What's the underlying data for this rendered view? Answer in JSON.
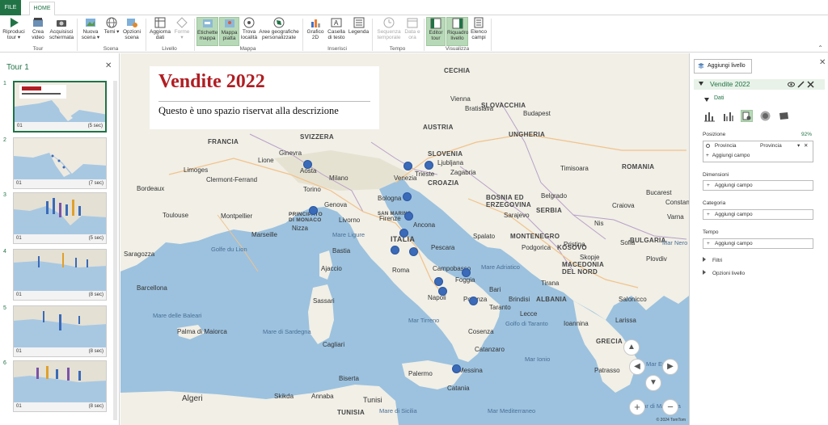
{
  "ribbon_tabs": {
    "file": "FILE",
    "home": "HOME"
  },
  "ribbon": {
    "tour_buttons": [
      "Riproduci tour ▾",
      "Crea video",
      "Acquisisci schermata"
    ],
    "scene_buttons": [
      "Nuova scena ▾",
      "Temi ▾",
      "Opzioni scena"
    ],
    "level_buttons": [
      "Aggiorna dati",
      "Forme ▾"
    ],
    "map_buttons": [
      "Etichette mappa",
      "Mappa piatta",
      "Trova località",
      "Aree geografiche personalizzate"
    ],
    "insert_buttons": [
      "Grafico 2D",
      "Casella di testo",
      "Legenda"
    ],
    "time_buttons": [
      "Sequenza temporale",
      "Data e ora"
    ],
    "view_buttons": [
      "Editor tour",
      "Riquadro livello",
      "Elenco campi"
    ],
    "groups": {
      "tour": "Tour",
      "scene": "Scena",
      "level": "Livello",
      "map": "Mappa",
      "insert": "Inserisci",
      "time": "Tempo",
      "view": "Visualizza"
    }
  },
  "tour_panel": {
    "title": "Tour 1",
    "scenes": [
      {
        "number": "1",
        "label": "01",
        "duration": "(5 sec)"
      },
      {
        "number": "2",
        "label": "01",
        "duration": "(7 sec)"
      },
      {
        "number": "3",
        "label": "01",
        "duration": "(5 sec)"
      },
      {
        "number": "4",
        "label": "01",
        "duration": "(8 sec)"
      },
      {
        "number": "5",
        "label": "01",
        "duration": "(8 sec)"
      },
      {
        "number": "6",
        "label": "01",
        "duration": "(8 sec)"
      }
    ]
  },
  "map": {
    "title": "Vendite 2022",
    "description": "Questo è uno spazio riservat alla descrizione",
    "copyright": "© 2024 TomTom",
    "countries": [
      "FRANCIA",
      "SVIZZERA",
      "AUSTRIA",
      "CECHIA",
      "SLOVACCHIA",
      "UNGHERIA",
      "SLOVENIA",
      "CROAZIA",
      "BOSNIA ED ERZEGOVINA",
      "SERBIA",
      "ROMANIA",
      "MONTENEGRO",
      "KOSOVO",
      "BULGARIA",
      "MACEDONIA DEL NORD",
      "ALBANIA",
      "ITALIA",
      "GRECIA",
      "TUNISIA",
      "PRINCIPATO DI MONACO",
      "SAN MARINO"
    ],
    "cities": [
      "Bordeaux",
      "Limoges",
      "Clermont-Ferrand",
      "Montpellier",
      "Marseille",
      "Toulouse",
      "Genova",
      "Torino",
      "Milano",
      "Aosta",
      "Venezia",
      "Trieste",
      "Zagabria",
      "Bologna",
      "Firenze",
      "Ancona",
      "Roma",
      "Napoli",
      "Foggia",
      "Bari",
      "Taranto",
      "Palermo",
      "Messina",
      "Catania",
      "Sarajevo",
      "Belgrado",
      "Bucarest",
      "Sofia",
      "Skopje",
      "Tirana",
      "Podgorica",
      "Budapest",
      "Vienna",
      "Bratislava",
      "Ljubljana",
      "Spalato",
      "Pristina",
      "Nis",
      "Craiova",
      "Timisoara",
      "Lione",
      "Ginevra",
      "Nizza",
      "Livorno",
      "Pescara",
      "Campobasso",
      "Potenza",
      "Catanzaro",
      "Cosenza",
      "Bastia",
      "Ajaccio",
      "Cagliari",
      "Sassari",
      "Algeri",
      "Tunisi",
      "Biserta",
      "Skikda",
      "Annaba",
      "Palma di Maiorca",
      "Barcellona",
      "Saragozza",
      "Salonicco",
      "Patrasso",
      "Larissa",
      "Ioannina",
      "Brindisi",
      "Lecce",
      "Plovdiv",
      "Varna",
      "Constanta"
    ],
    "seas": [
      "Mare Ligure",
      "Mare Adriatico",
      "Mar Tirreno",
      "Mar Ionio",
      "Mar Mediterraneo",
      "Mare delle Baleari",
      "Mare di Sardegna",
      "Golfe du Lion",
      "Mar Egeo",
      "Mare di Sicilia",
      "Mar di Marmara",
      "Mar Nero",
      "Golfo di Taranto"
    ],
    "data_points": 19,
    "nav": {
      "up": "▲",
      "left": "◀",
      "right": "▶",
      "down": "▼",
      "zoom_in": "+",
      "zoom_out": "−"
    }
  },
  "layer_pane": {
    "add_layer": "Aggiungi livello",
    "layer_name": "Vendite 2022",
    "section_data": "Dati",
    "position_label": "Posizione",
    "position_percent": "92%",
    "position_field": "Provincia",
    "position_type": "Provincia",
    "add_field": "Aggiungi campo",
    "dimension_label": "Dimensioni",
    "category_label": "Categoria",
    "time_label": "Tempo",
    "filters": "Filtri",
    "layer_options": "Opzioni livello"
  },
  "colors": {
    "accent": "#217346",
    "title_red": "#b01e23",
    "point_blue": "#3a6ab8",
    "sea": "#9cc2df",
    "land": "#f1efe6"
  }
}
